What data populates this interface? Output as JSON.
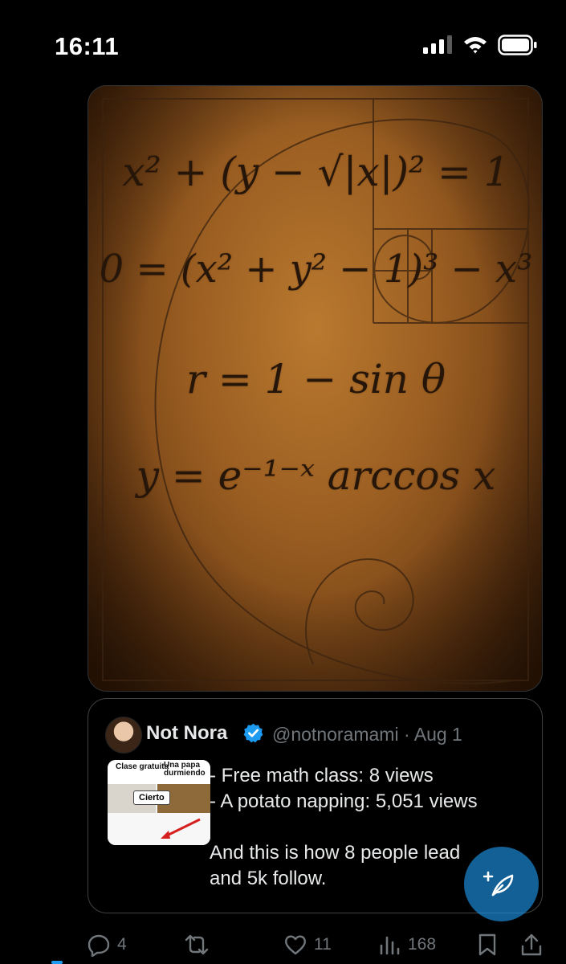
{
  "status_bar": {
    "time": "16:11"
  },
  "media": {
    "formulas": [
      "x² + (y − √|x|)² = 1",
      "0 = (x² + y² − 1)³ − x³",
      "r = 1 − sin θ",
      "y = e⁻¹⁻ˣ arccos x"
    ]
  },
  "quoted_post": {
    "author_name": "Not Nora",
    "handle_and_date": "@notnoramami · Aug 1",
    "thumbnail": {
      "tag_left": "Clase gratuita",
      "tag_right": "Una papa durmiendo",
      "label": "Cierto"
    },
    "lines": [
      "- Free math class: 8 views",
      "- A potato napping: 5,051 views",
      "",
      "And this is how 8 people lead",
      "and 5k follow."
    ]
  },
  "actions": {
    "reply_count": "4",
    "like_count": "11",
    "view_count": "168"
  },
  "colors": {
    "background": "#000000",
    "accent": "#1d9bf0",
    "muted": "#71767b"
  },
  "icons": [
    "signal-icon",
    "wifi-icon",
    "battery-icon",
    "verified-badge-icon",
    "compose-feather-icon",
    "reply-icon",
    "repost-icon",
    "like-icon",
    "views-icon",
    "bookmark-icon",
    "share-icon"
  ]
}
